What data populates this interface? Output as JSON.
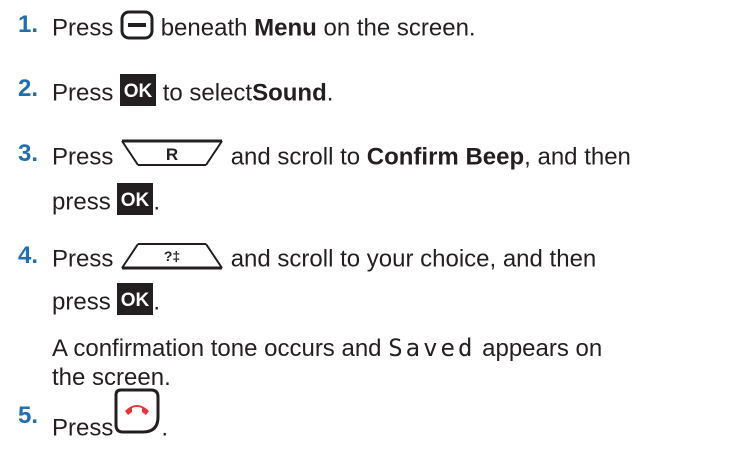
{
  "steps": [
    {
      "num": "1.",
      "pre": "Press",
      "after": "beneath",
      "bold": "Menu",
      "tail": "on the screen.",
      "icon": "menu-softkey-icon"
    },
    {
      "num": "2.",
      "pre": "Press",
      "ok_label": "OK",
      "after": "to select",
      "bold": "Sound",
      "tail": ".",
      "icon": "ok-key-icon"
    },
    {
      "num": "3.",
      "pre": "Press",
      "key_label": "R",
      "after": "and scroll to",
      "bold": "Confirm Beep",
      "tail": ", and then",
      "line2_pre": "press",
      "ok_label": "OK",
      "line2_tail": ".",
      "icon": "redial-key-icon"
    },
    {
      "num": "4.",
      "pre": "Press",
      "key_label": "?‡",
      "after": "and scroll to your choice, and then",
      "line2_pre": "press",
      "ok_label": "OK",
      "line2_tail": ".",
      "icon": "directory-key-icon"
    },
    {
      "num": "5.",
      "pre": "Press",
      "tail": ".",
      "icon": "end-call-key-icon"
    }
  ],
  "note": {
    "pre": "A confirmation tone occurs and",
    "saved": "Saved",
    "post": "appears on",
    "line2": "the screen."
  },
  "colors": {
    "step_number": "#1f6fb2",
    "end_call": "#e8343a",
    "text": "#231f20"
  }
}
